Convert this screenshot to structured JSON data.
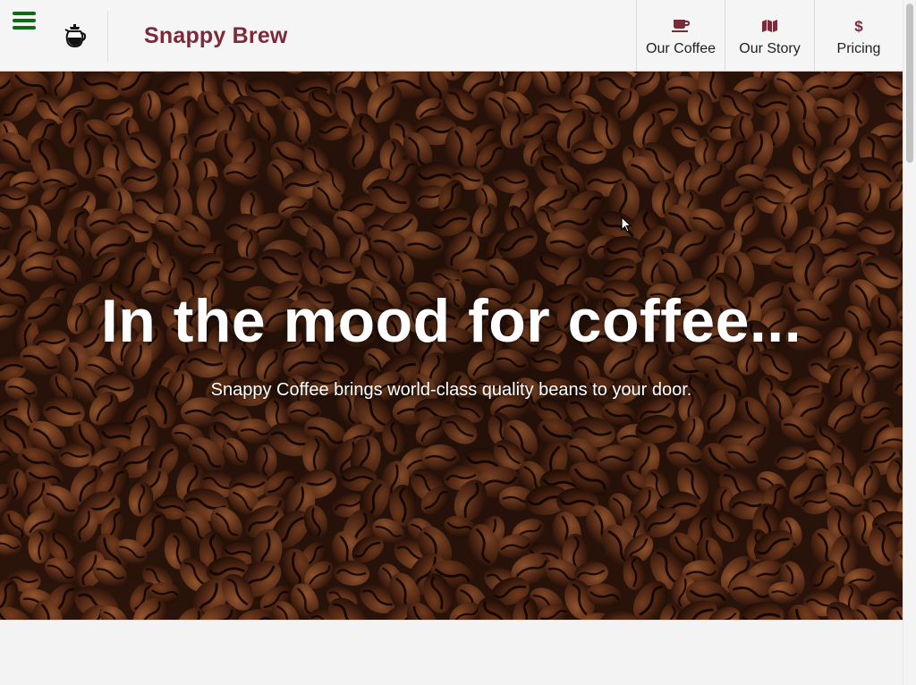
{
  "header": {
    "brand": "Snappy Brew",
    "icons": {
      "menu": "hamburger-menu-icon",
      "logo": "coffee-pot-icon"
    },
    "colors": {
      "brand": "#7b2a3a",
      "menu": "#0e6b10"
    }
  },
  "nav": {
    "items": [
      {
        "label": "Our Coffee",
        "icon": "coffee-cup-icon"
      },
      {
        "label": "Our Story",
        "icon": "map-icon"
      },
      {
        "label": "Pricing",
        "icon": "dollar-icon"
      }
    ]
  },
  "hero": {
    "title": "In the mood for coffee...",
    "subtitle": "Snappy Coffee brings world-class quality beans to your door.",
    "background": "coffee-beans-photo"
  }
}
